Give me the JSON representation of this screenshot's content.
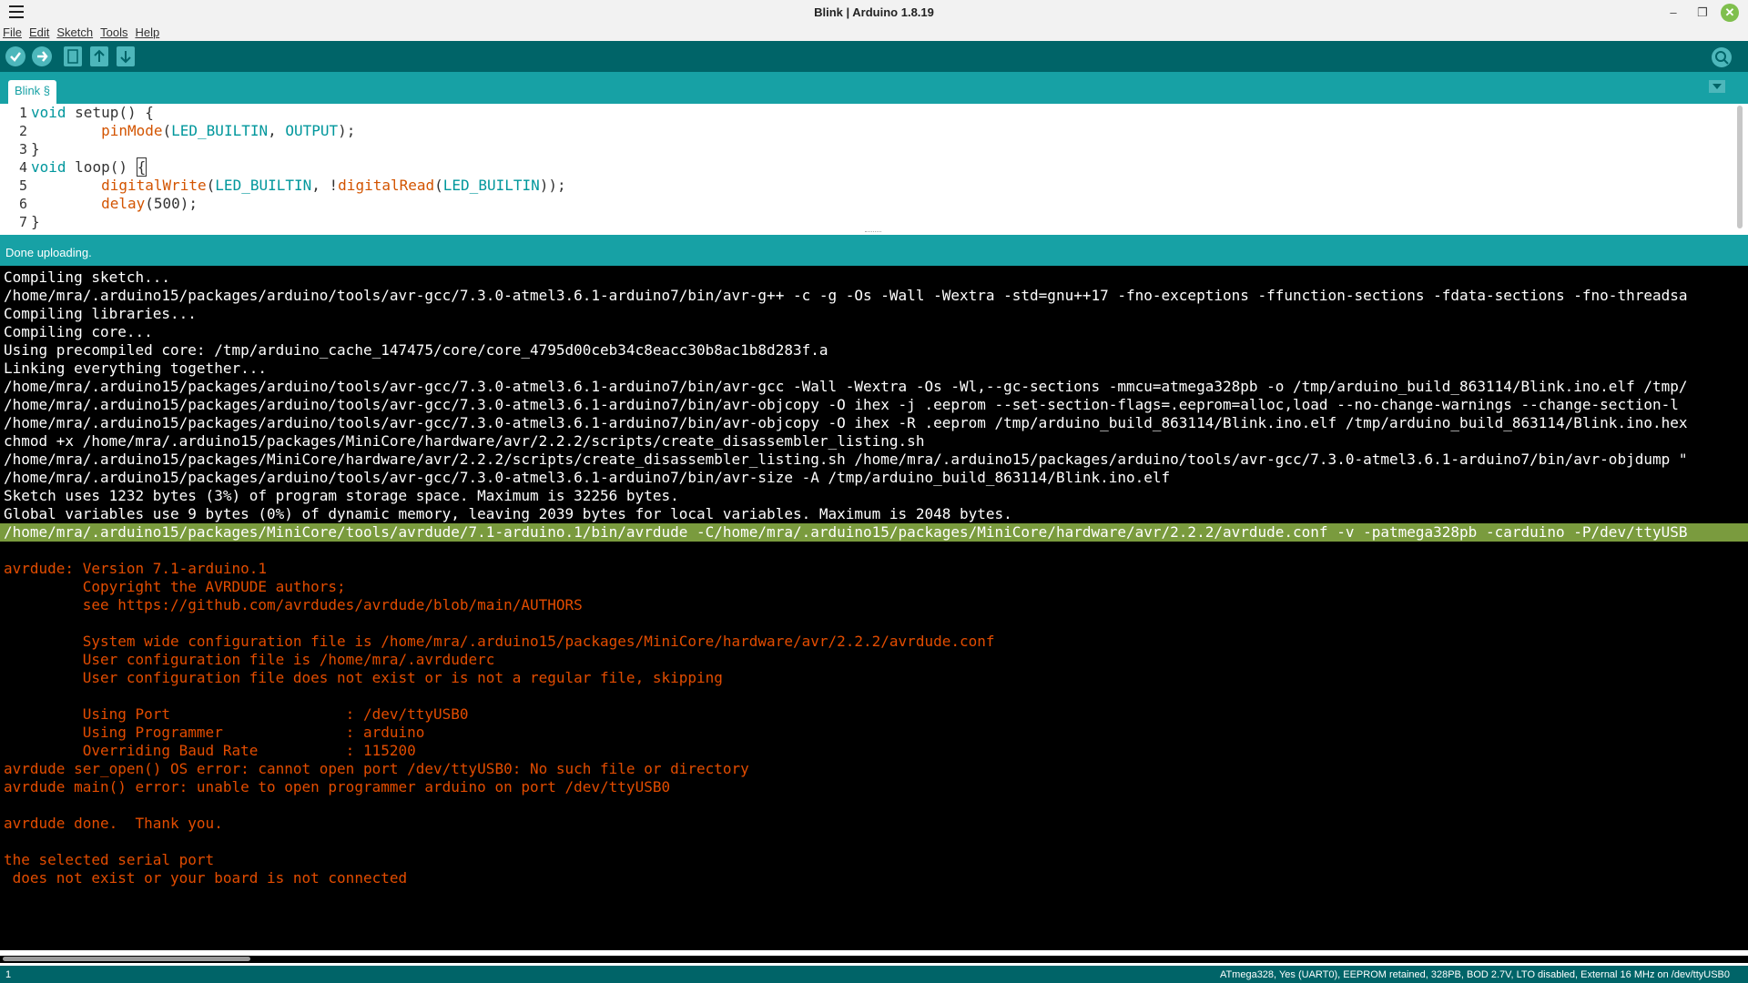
{
  "window": {
    "title": "Blink | Arduino 1.8.19"
  },
  "menu": [
    "File",
    "Edit",
    "Sketch",
    "Tools",
    "Help"
  ],
  "toolbar": {
    "verify": "check-icon",
    "upload": "arrow-right-icon",
    "new": "new-file-icon",
    "open": "arrow-up-icon",
    "save": "arrow-down-icon",
    "serial_monitor": "magnifier-icon"
  },
  "tabs": [
    {
      "label": "Blink §"
    }
  ],
  "editor": {
    "line_numbers": [
      "1",
      "2",
      "3",
      "4",
      "5",
      "6",
      "7"
    ]
  },
  "status": {
    "message": "Done uploading."
  },
  "console": {
    "lines": [
      "Compiling sketch...",
      "/home/mra/.arduino15/packages/arduino/tools/avr-gcc/7.3.0-atmel3.6.1-arduino7/bin/avr-g++ -c -g -Os -Wall -Wextra -std=gnu++17 -fno-exceptions -ffunction-sections -fdata-sections -fno-threadsa",
      "Compiling libraries...",
      "Compiling core...",
      "Using precompiled core: /tmp/arduino_cache_147475/core/core_4795d00ceb34c8eacc30b8ac1b8d283f.a",
      "Linking everything together...",
      "/home/mra/.arduino15/packages/arduino/tools/avr-gcc/7.3.0-atmel3.6.1-arduino7/bin/avr-gcc -Wall -Wextra -Os -Wl,--gc-sections -mmcu=atmega328pb -o /tmp/arduino_build_863114/Blink.ino.elf /tmp/",
      "/home/mra/.arduino15/packages/arduino/tools/avr-gcc/7.3.0-atmel3.6.1-arduino7/bin/avr-objcopy -O ihex -j .eeprom --set-section-flags=.eeprom=alloc,load --no-change-warnings --change-section-l",
      "/home/mra/.arduino15/packages/arduino/tools/avr-gcc/7.3.0-atmel3.6.1-arduino7/bin/avr-objcopy -O ihex -R .eeprom /tmp/arduino_build_863114/Blink.ino.elf /tmp/arduino_build_863114/Blink.ino.hex",
      "chmod +x /home/mra/.arduino15/packages/MiniCore/hardware/avr/2.2.2/scripts/create_disassembler_listing.sh",
      "/home/mra/.arduino15/packages/MiniCore/hardware/avr/2.2.2/scripts/create_disassembler_listing.sh /home/mra/.arduino15/packages/arduino/tools/avr-gcc/7.3.0-atmel3.6.1-arduino7/bin/avr-objdump \"",
      "/home/mra/.arduino15/packages/arduino/tools/avr-gcc/7.3.0-atmel3.6.1-arduino7/bin/avr-size -A /tmp/arduino_build_863114/Blink.ino.elf",
      "Sketch uses 1232 bytes (3%) of program storage space. Maximum is 32256 bytes.",
      "Global variables use 9 bytes (0%) of dynamic memory, leaving 2039 bytes for local variables. Maximum is 2048 bytes.",
      "/home/mra/.arduino15/packages/MiniCore/tools/avrdude/7.1-arduino.1/bin/avrdude -C/home/mra/.arduino15/packages/MiniCore/hardware/avr/2.2.2/avrdude.conf -v -patmega328pb -carduino -P/dev/ttyUSB",
      "",
      "avrdude: Version 7.1-arduino.1",
      "         Copyright the AVRDUDE authors;",
      "         see https://github.com/avrdudes/avrdude/blob/main/AUTHORS",
      "",
      "         System wide configuration file is /home/mra/.arduino15/packages/MiniCore/hardware/avr/2.2.2/avrdude.conf",
      "         User configuration file is /home/mra/.avrduderc",
      "         User configuration file does not exist or is not a regular file, skipping",
      "",
      "         Using Port                    : /dev/ttyUSB0",
      "         Using Programmer              : arduino",
      "         Overriding Baud Rate          : 115200",
      "avrdude ser_open() OS error: cannot open port /dev/ttyUSB0: No such file or directory",
      "avrdude main() error: unable to open programmer arduino on port /dev/ttyUSB0",
      "",
      "avrdude done.  Thank you.",
      "",
      "the selected serial port",
      " does not exist or your board is not connected"
    ]
  },
  "footer": {
    "line": "1",
    "board": "ATmega328, Yes (UART0), EEPROM retained, 328PB, BOD 2.7V, LTO disabled, External 16 MHz on /dev/ttyUSB0"
  },
  "colors": {
    "toolbar": "#006468",
    "tabbar": "#17a1a5",
    "console_bg": "#000000",
    "error_text": "#e34c00",
    "highlight": "#7a9b3e"
  }
}
